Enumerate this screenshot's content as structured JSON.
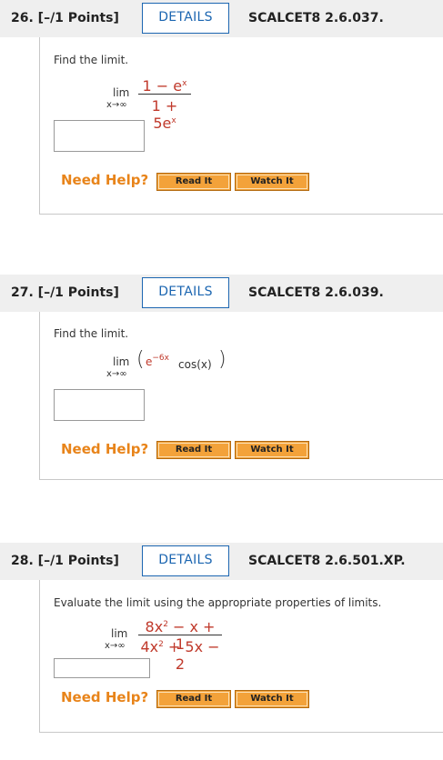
{
  "questions": [
    {
      "title": "26. [–/1 Points]",
      "details_label": "DETAILS",
      "code": "SCALCET8 2.6.037.",
      "prompt": "Find the limit.",
      "lim": "lim",
      "sub": "x→∞",
      "num": "1 − e",
      "num_sup": "x",
      "den": "1 + 5e",
      "den_sup": "x",
      "need_help": "Need Help?",
      "read_it": "Read It",
      "watch_it": "Watch It"
    },
    {
      "title": "27. [–/1 Points]",
      "details_label": "DETAILS",
      "code": "SCALCET8 2.6.039.",
      "prompt": "Find the limit.",
      "lim": "lim",
      "sub": "x→∞",
      "expr_base": "e",
      "expr_sup": "−6x",
      "expr_rest": "cos(x)",
      "need_help": "Need Help?",
      "read_it": "Read It",
      "watch_it": "Watch It"
    },
    {
      "title": "28. [–/1 Points]",
      "details_label": "DETAILS",
      "code": "SCALCET8 2.6.501.XP.",
      "prompt": "Evaluate the limit using the appropriate properties of limits.",
      "lim": "lim",
      "sub": "x→∞",
      "num_a": "8x",
      "num_a_sup": "2",
      "num_b": " − x + 1",
      "den_a": "4x",
      "den_a_sup": "2",
      "den_b": " + 5x − 2",
      "need_help": "Need Help?",
      "read_it": "Read It",
      "watch_it": "Watch It"
    }
  ]
}
